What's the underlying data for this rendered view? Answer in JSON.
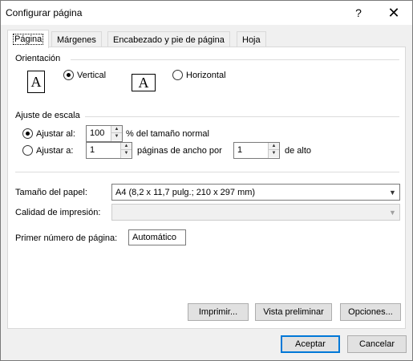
{
  "window": {
    "title": "Configurar página",
    "help_glyph": "?",
    "close_glyph": "✕"
  },
  "tabs": [
    {
      "label": "Página",
      "active": true
    },
    {
      "label": "Márgenes",
      "active": false
    },
    {
      "label": "Encabezado y pie de página",
      "active": false
    },
    {
      "label": "Hoja",
      "active": false
    }
  ],
  "orientation": {
    "group_label": "Orientación",
    "icon_letter": "A",
    "vertical_label": "Vertical",
    "horizontal_label": "Horizontal",
    "selected": "vertical"
  },
  "scaling": {
    "group_label": "Ajuste de escala",
    "adjust_to_label": "Ajustar al:",
    "adjust_to_value": "100",
    "adjust_to_suffix": "% del tamaño normal",
    "fit_to_label": "Ajustar a:",
    "fit_wide_value": "1",
    "fit_wide_suffix": "páginas de ancho por",
    "fit_tall_value": "1",
    "fit_tall_suffix": "de alto",
    "selected": "adjust_to"
  },
  "paper": {
    "size_label": "Tamaño del papel:",
    "size_value": "A4 (8,2 x 11,7 pulg.; 210 x 297 mm)",
    "quality_label": "Calidad de impresión:",
    "quality_value": "",
    "first_page_label": "Primer número de página:",
    "first_page_value": "Automático"
  },
  "buttons": {
    "print": "Imprimir...",
    "preview": "Vista preliminar",
    "options": "Opciones...",
    "accept": "Aceptar",
    "cancel": "Cancelar"
  },
  "colors": {
    "accent": "#0078d7",
    "panel": "#ffffff",
    "background": "#f0f0f0"
  }
}
